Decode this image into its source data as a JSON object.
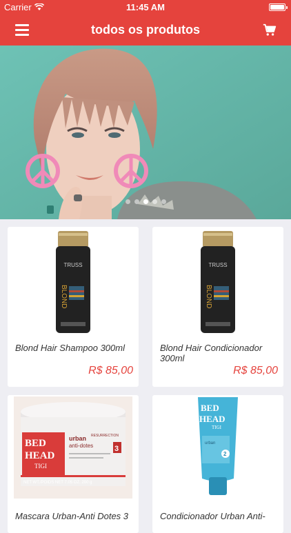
{
  "status_bar": {
    "carrier": "Carrier",
    "time": "11:45 AM",
    "battery_level": 1.0
  },
  "nav": {
    "title": "todos os produtos",
    "menu_icon": "hamburger-icon",
    "cart_icon": "cart-icon"
  },
  "banner": {
    "slides": 5,
    "active_slide": 2,
    "description_colors": {
      "background": "#64b3a6",
      "accent": "#e5433d"
    }
  },
  "products": [
    {
      "name": "Blond Hair Shampoo 300ml",
      "price": "R$ 85,00"
    },
    {
      "name": "Blond Hair Condicionador 300ml",
      "price": "R$ 85,00"
    },
    {
      "name": "Mascara Urban-Anti Dotes 3",
      "price": ""
    },
    {
      "name": "Condicionador Urban Anti-",
      "price": ""
    }
  ],
  "product_labels": {
    "truss": "TRUSS",
    "blond": "BLOND",
    "bed_head_1": "BED",
    "bed_head_2": "HEAD",
    "tigi": "TIGI",
    "urban": "urban",
    "anti_dotes": "anti-dotes",
    "resurrection": "RESURRECTION",
    "size": "NET WT./POIDS NET 7.05 OZ. 200 g",
    "number_3": "3",
    "number_2": "2"
  },
  "colors": {
    "accent": "#e5433d",
    "background": "#eeeef3"
  }
}
